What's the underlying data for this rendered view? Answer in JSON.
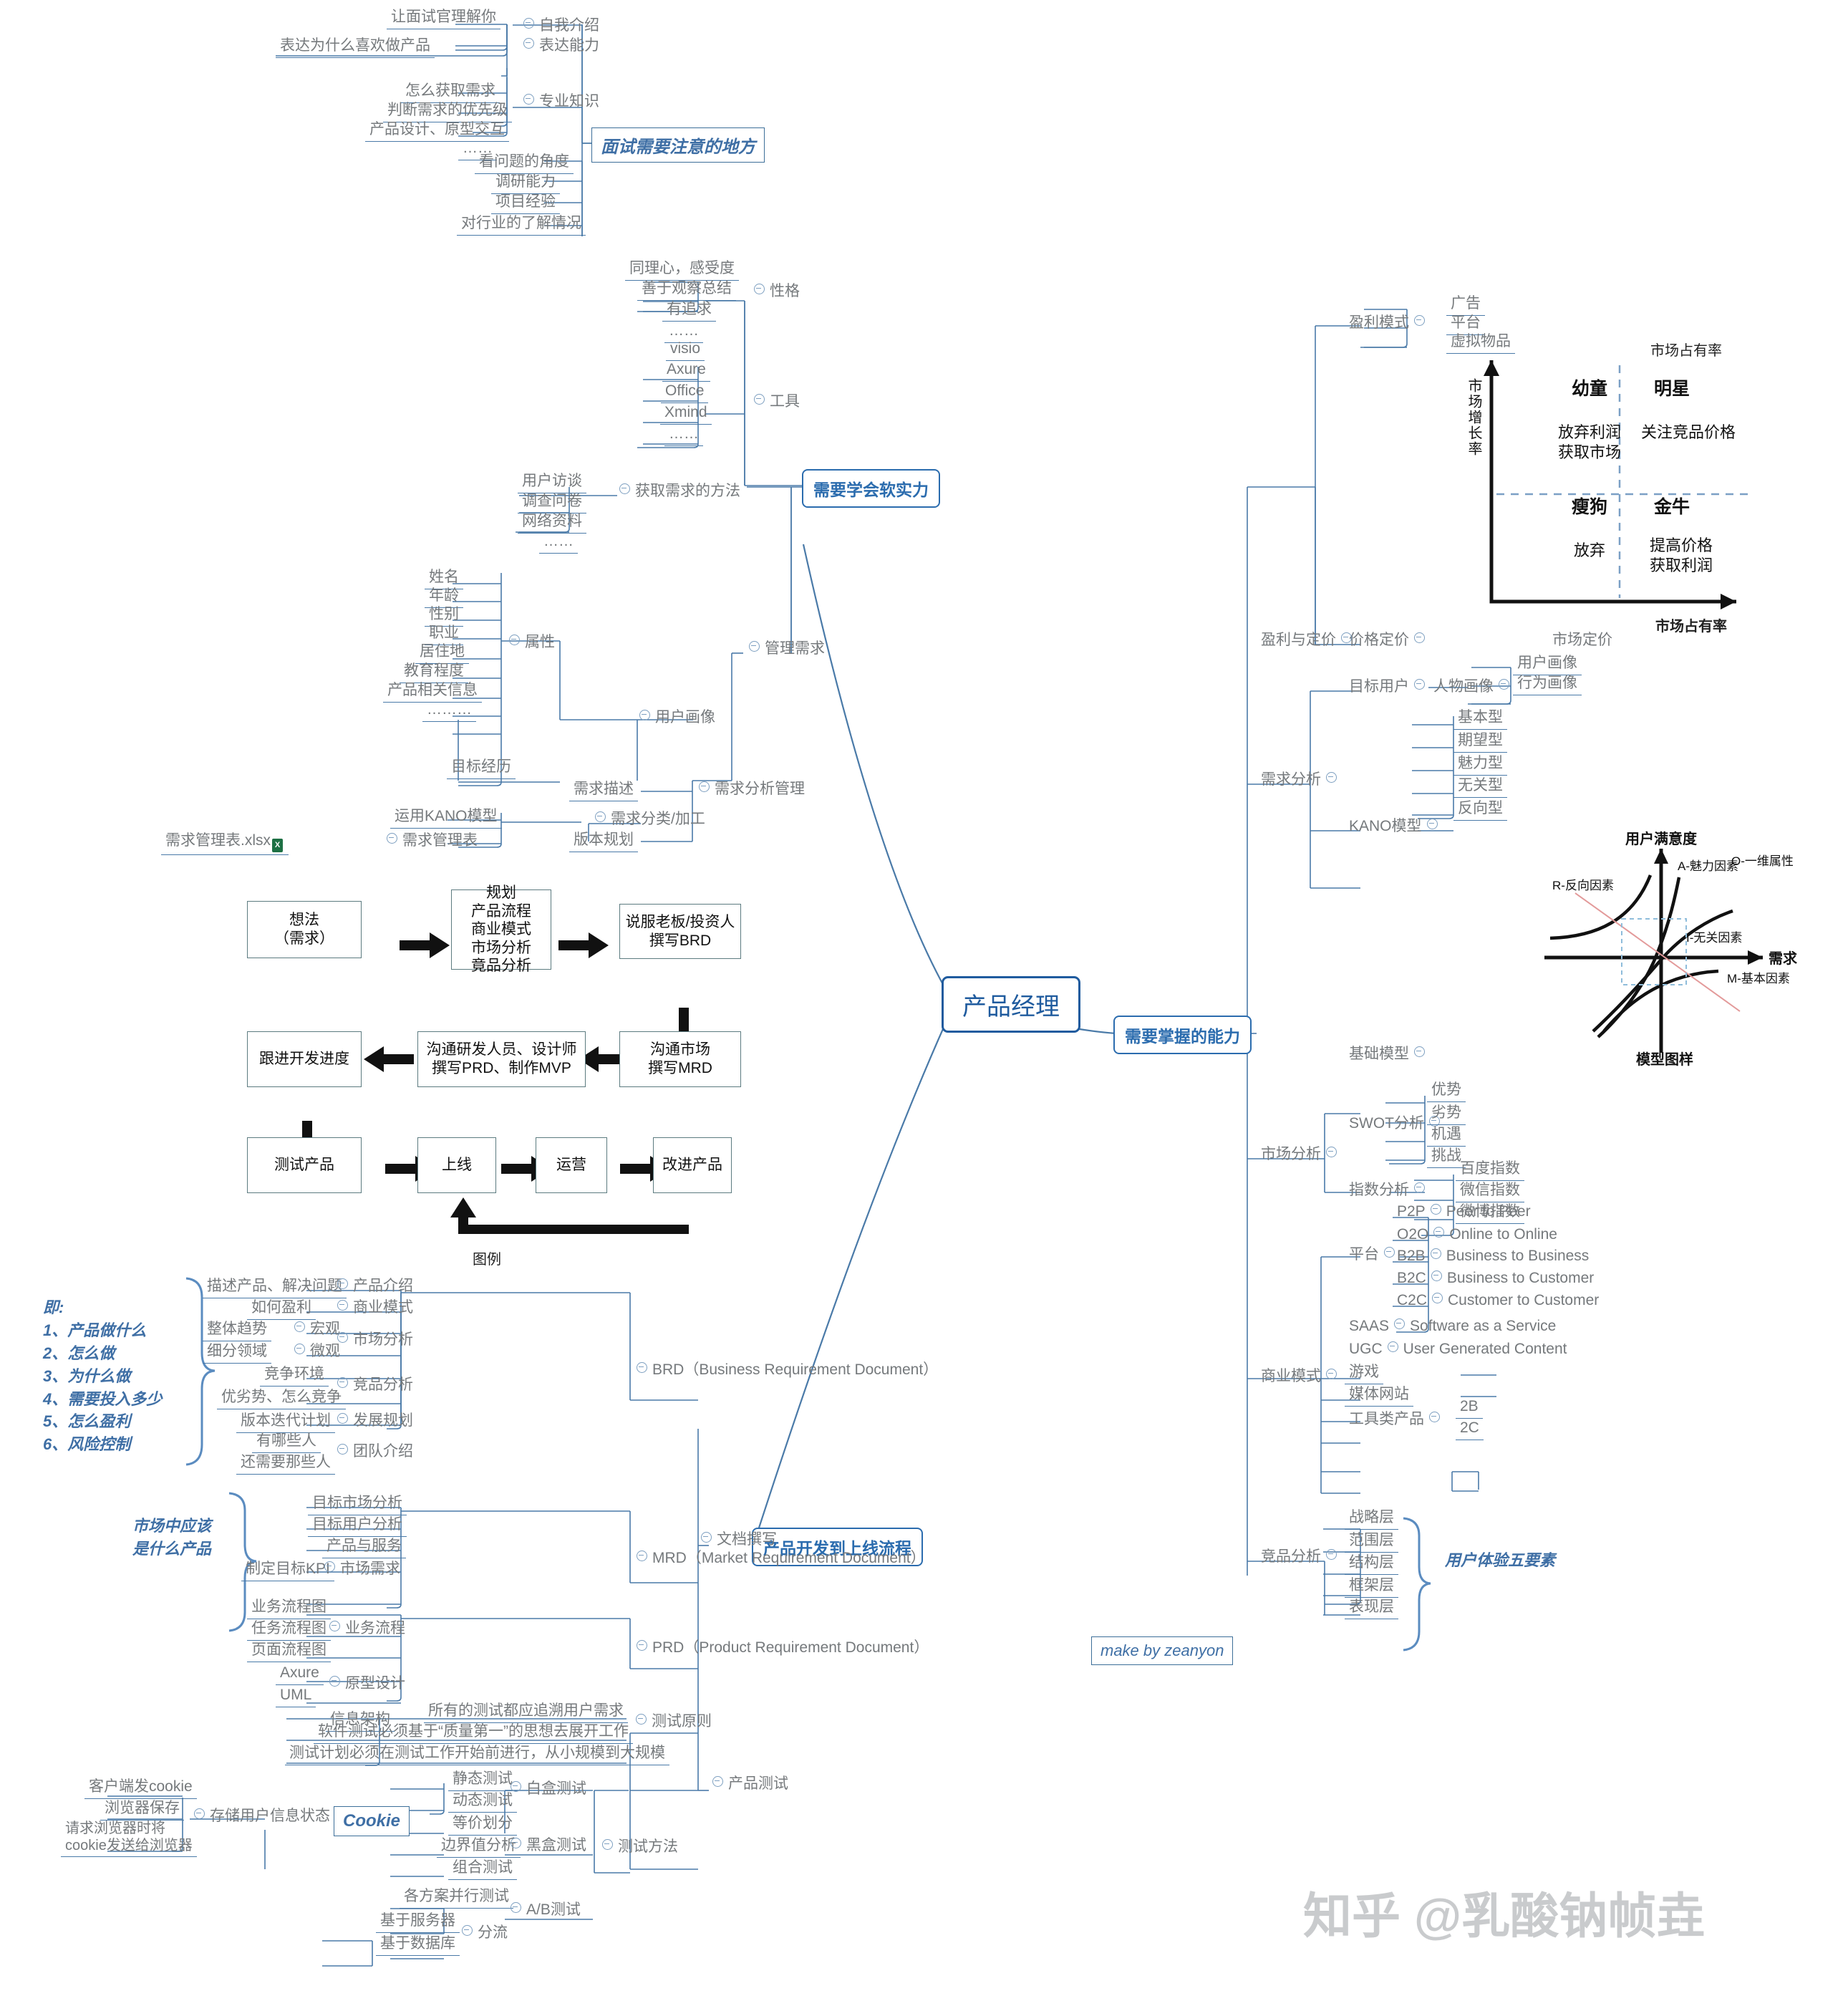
{
  "central": {
    "label": "产品经理"
  },
  "main_branches": [
    {
      "id": "soft",
      "label": "需要学会软实力"
    },
    {
      "id": "ability",
      "label": "需要掌握的能力"
    },
    {
      "id": "flow",
      "label": "产品开发到上线流程"
    }
  ],
  "boxed_notes": [
    {
      "id": "interview",
      "label": "面试需要注意的地方"
    },
    {
      "id": "cookie",
      "label": "Cookie"
    },
    {
      "id": "credit",
      "label": "make by zeanyon"
    }
  ],
  "interview": {
    "title": "面试需要注意的地方",
    "children": [
      {
        "label": "自我介绍",
        "children": [
          "让面试官理解你"
        ]
      },
      {
        "label": "表达能力",
        "children": [
          "表达为什么喜欢做产品"
        ]
      },
      {
        "label": "专业知识",
        "children": [
          "怎么获取需求",
          "判断需求的优先级",
          "产品设计、原型交互",
          "……"
        ]
      },
      {
        "label": "看问题的角度",
        "children": []
      },
      {
        "label": "调研能力",
        "children": []
      },
      {
        "label": "项目经验",
        "children": []
      },
      {
        "label": "对行业的了解情况",
        "children": []
      }
    ]
  },
  "soft_skills": {
    "title": "需要学会软实力",
    "children": [
      {
        "label": "性格",
        "children": [
          "同理心，感受度",
          "善于观察总结",
          "有追求",
          "……"
        ]
      },
      {
        "label": "工具",
        "children": [
          "visio",
          "Axure",
          "Office",
          "Xmind",
          "……"
        ]
      },
      {
        "label": "管理需求",
        "children": [
          {
            "label": "获取需求的方法",
            "children": [
              "用户访谈",
              "调查问卷",
              "网络资料",
              "……"
            ]
          },
          {
            "label": "需求分析管理",
            "children": [
              {
                "label": "用户画像",
                "children": [
                  {
                    "label": "属性",
                    "children": [
                      "姓名",
                      "年龄",
                      "性别",
                      "职业",
                      "居住地",
                      "教育程度",
                      "产品相关信息",
                      "………"
                    ]
                  },
                  {
                    "label": "目标经历",
                    "children": []
                  }
                ]
              },
              {
                "label": "需求描述",
                "children": []
              },
              {
                "label": "需求分类/加工",
                "children": [
                  {
                    "label": "运用KANO模型",
                    "children": []
                  },
                  {
                    "label": "需求管理表",
                    "children": [
                      "需求管理表.xlsx"
                    ]
                  }
                ]
              },
              {
                "label": "版本规划",
                "children": []
              }
            ]
          }
        ]
      }
    ]
  },
  "flowchart": {
    "caption": "图例",
    "boxes": [
      {
        "id": "idea",
        "label": "想法\n（需求）"
      },
      {
        "id": "plan",
        "label": "规划\n产品流程\n商业模式\n市场分析\n竟品分析"
      },
      {
        "id": "brd",
        "label": "说服老板/投资人\n撰写BRD"
      },
      {
        "id": "mrd",
        "label": "沟通市场\n撰写MRD"
      },
      {
        "id": "prd",
        "label": "沟通研发人员、设计师\n撰写PRD、制作MVP"
      },
      {
        "id": "dev",
        "label": "跟进开发进度"
      },
      {
        "id": "test",
        "label": "测试产品"
      },
      {
        "id": "launch",
        "label": "上线"
      },
      {
        "id": "ops",
        "label": "运营"
      },
      {
        "id": "improve",
        "label": "改进产品"
      }
    ]
  },
  "process": {
    "title": "产品开发到上线流程",
    "doc_writing": {
      "label": "文档撰写"
    },
    "brd_note": "即:\n1、产品做什么\n2、怎么做\n3、为什么做\n4、需要投入多少\n5、怎么盈利\n6、风险控制",
    "mrd_note": "市场中应该\n是什么产品",
    "brd": {
      "label": "BRD（Business Requirement Document）",
      "children": [
        {
          "label": "产品介绍",
          "children": [
            "描述产品、解决问题"
          ]
        },
        {
          "label": "商业模式",
          "children": [
            "如何盈利"
          ]
        },
        {
          "label": "市场分析",
          "children": [
            {
              "label": "宏观",
              "children": [
                "整体趋势"
              ]
            },
            {
              "label": "微观",
              "children": [
                "细分领域"
              ]
            }
          ]
        },
        {
          "label": "竞品分析",
          "children": [
            "竞争环境",
            "优劣势、怎么竞争"
          ]
        },
        {
          "label": "发展规划",
          "children": [
            "版本迭代计划"
          ]
        },
        {
          "label": "团队介绍",
          "children": [
            "有哪些人",
            "还需要那些人"
          ]
        }
      ]
    },
    "mrd": {
      "label": "MRD（Market Requirement Document）",
      "children": [
        {
          "label": "目标市场分析",
          "children": []
        },
        {
          "label": "目标用户分析",
          "children": []
        },
        {
          "label": "产品与服务",
          "children": []
        },
        {
          "label": "市场需求",
          "children": [
            "制定目标KPI"
          ]
        }
      ]
    },
    "prd": {
      "label": "PRD（Product Requirement Document）",
      "children": [
        {
          "label": "业务流程",
          "children": [
            "业务流程图",
            "任务流程图",
            "页面流程图"
          ]
        },
        {
          "label": "原型设计",
          "children": [
            "Axure",
            "UML"
          ]
        },
        {
          "label": "信息架构",
          "children": []
        }
      ]
    },
    "product_test": {
      "label": "产品测试",
      "children": [
        {
          "label": "测试原则",
          "children": [
            "所有的测试都应追溯用户需求",
            "软件测试必须基于“质量第一”的思想去展开工作",
            "测试计划必须在测试工作开始前进行，从小规模到大规模"
          ]
        },
        {
          "label": "测试方法",
          "children": [
            {
              "label": "白盒测试",
              "children": [
                "静态测试",
                "动态测试"
              ]
            },
            {
              "label": "黑盒测试",
              "children": [
                "等价划分",
                "边界值分析",
                "组合测试"
              ]
            },
            {
              "label": "A/B测试",
              "children": [
                {
                  "label": "各方案并行测试",
                  "children": []
                },
                {
                  "label": "分流",
                  "children": [
                    "基于服务器",
                    "基于数据库"
                  ]
                }
              ]
            }
          ]
        }
      ]
    },
    "cookie": {
      "label": "Cookie",
      "children": [
        {
          "label": "存储用户信息状态",
          "children": [
            "客户端发cookie",
            "浏览器保存",
            "请求浏览器时将\ncookie发送给浏览器"
          ]
        }
      ]
    }
  },
  "ability": {
    "title": "需要掌握的能力",
    "children": [
      {
        "label": "盈利与定价",
        "children": [
          {
            "label": "盈利模式",
            "children": [
              "广告",
              "平台",
              "虚拟物品"
            ]
          },
          {
            "label": "价格定价",
            "children": [
              "市场定价"
            ]
          }
        ]
      },
      {
        "label": "需求分析",
        "children": [
          {
            "label": "目标用户",
            "children": [
              {
                "label": "人物画像",
                "children": [
                  "用户画像",
                  "行为画像"
                ]
              }
            ]
          },
          {
            "label": "KANO模型",
            "children": [
              "基本型",
              "期望型",
              "魅力型",
              "无关型",
              "反向型"
            ]
          },
          {
            "label": "基础模型",
            "children": [
              "模型图样"
            ]
          }
        ]
      },
      {
        "label": "市场分析",
        "children": [
          {
            "label": "SWOT分析",
            "children": [
              "优势",
              "劣势",
              "机遇",
              "挑战"
            ]
          },
          {
            "label": "指数分析",
            "children": [
              "百度指数",
              "微信指数",
              "微博指数"
            ]
          }
        ]
      },
      {
        "label": "商业模式",
        "children": [
          {
            "label": "平台",
            "children": [
              {
                "label": "P2P",
                "children": [
                  "Peer to Peer"
                ]
              },
              {
                "label": "O2O",
                "children": [
                  "Online to Online"
                ]
              },
              {
                "label": "B2B",
                "children": [
                  "Business to Business"
                ]
              },
              {
                "label": "B2C",
                "children": [
                  "Business to Customer"
                ]
              },
              {
                "label": "C2C",
                "children": [
                  "Customer to Customer"
                ]
              }
            ]
          },
          {
            "label": "SAAS",
            "children": [
              "Software as a Service"
            ]
          },
          {
            "label": "UGC",
            "children": [
              "User Generated Content"
            ]
          },
          {
            "label": "游戏",
            "children": []
          },
          {
            "label": "媒体网站",
            "children": []
          },
          {
            "label": "工具类产品",
            "children": [
              "2B",
              "2C"
            ]
          }
        ]
      },
      {
        "label": "竞品分析",
        "children": [
          "战略层",
          "范围层",
          "结构层",
          "框架层",
          "表现层"
        ],
        "note": "用户体验五要素"
      }
    ]
  },
  "bcg_matrix": {
    "y_axis": "市场增长率",
    "x_axis": "市场占有率",
    "quadrants": [
      {
        "name": "幼童",
        "text": "放弃利润\n获取市场"
      },
      {
        "name": "明星",
        "text": "关注竞品价格"
      },
      {
        "name": "瘦狗",
        "text": "放弃"
      },
      {
        "name": "金牛",
        "text": "提高价格\n获取利润"
      }
    ]
  },
  "kano_chart": {
    "y_axis": "用户满意度",
    "x_axis": "需求",
    "caption": "模型图样",
    "labels": [
      "A-魅力因素",
      "O-一维属性",
      "R-反向因素",
      "I-无关因素",
      "M-基本因素"
    ]
  },
  "watermark": {
    "text": "知乎 @乳酸钠帧垚"
  },
  "colors": {
    "branch_line": "#4a7aa8",
    "central_border": "#1f5b9e",
    "node_text": "#75797c",
    "accent": "#3f6fa5"
  }
}
